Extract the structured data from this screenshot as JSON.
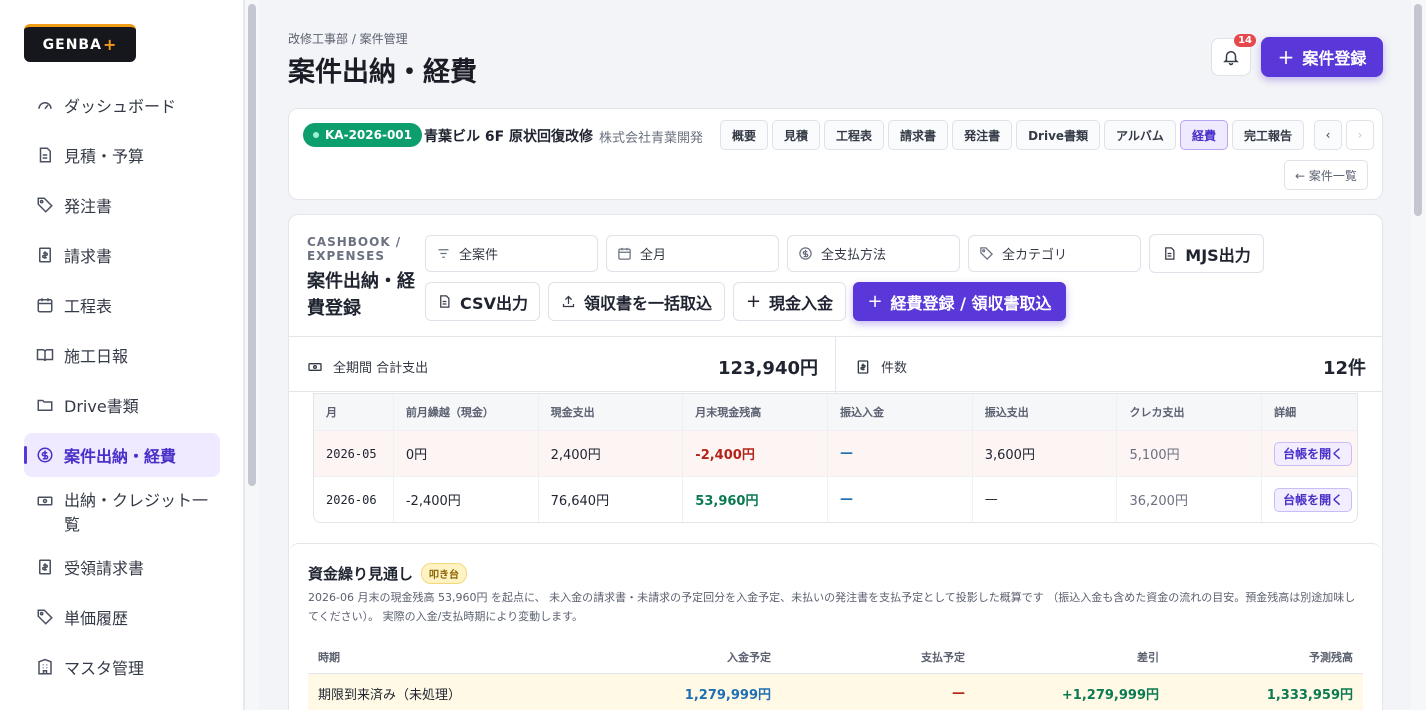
{
  "app": {
    "logo_text": "GENBA",
    "logo_plus": "+"
  },
  "sidebar": {
    "items": [
      {
        "label": "ダッシュボード",
        "icon": "gauge-icon"
      },
      {
        "label": "見積・予算",
        "icon": "document-icon"
      },
      {
        "label": "発注書",
        "icon": "tag-icon"
      },
      {
        "label": "請求書",
        "icon": "invoice-icon"
      },
      {
        "label": "工程表",
        "icon": "calendar-icon"
      },
      {
        "label": "施工日報",
        "icon": "book-icon"
      },
      {
        "label": "Drive書類",
        "icon": "folder-icon"
      },
      {
        "label": "案件出納・経費",
        "icon": "dollar-circle-icon",
        "active": true
      },
      {
        "label": "出納・クレジット一覧",
        "icon": "cash-icon"
      },
      {
        "label": "受領請求書",
        "icon": "invoice-icon"
      },
      {
        "label": "単価履歴",
        "icon": "tag-icon"
      },
      {
        "label": "マスタ管理",
        "icon": "building-icon"
      }
    ]
  },
  "header": {
    "breadcrumb": "改修工事部 / 案件管理",
    "title": "案件出納・経費",
    "notification_count": "14",
    "new_project_label": "案件登録"
  },
  "project": {
    "code": "KA-2026-001",
    "name": "青葉ビル 6F 原状回復改修",
    "client": "株式会社青葉開発",
    "tabs": [
      "概要",
      "見積",
      "工程表",
      "請求書",
      "発注書",
      "Drive書類",
      "アルバム",
      "経費",
      "完工報告"
    ],
    "active_tab": "経費",
    "back_label": "← 案件一覧",
    "prev_arrow": "‹",
    "next_arrow": "›"
  },
  "cashbook": {
    "subtitle": "CASHBOOK / EXPENSES",
    "title": "案件出納・経費登録",
    "filters": {
      "project": "全案件",
      "month": "全月",
      "payment_method": "全支払方法",
      "category": "全カテゴリ"
    },
    "buttons": {
      "mjs": "MJS出力",
      "csv": "CSV出力",
      "bulk_receipt": "領収書を一括取込",
      "cash_in": "現金入金",
      "register": "経費登録 / 領収書取込"
    },
    "stats": {
      "total_label": "全期間 合計支出",
      "total_value": "123,940円",
      "count_label": "件数",
      "count_value": "12件"
    },
    "monthly_table": {
      "headers": [
        "月",
        "前月繰越（現金）",
        "現金支出",
        "月末現金残高",
        "振込入金",
        "振込支出",
        "クレカ支出",
        "詳細"
      ],
      "rows": [
        {
          "month": "2026-05",
          "carry": "0円",
          "cash_out": "2,400円",
          "balance": "-2,400円",
          "transfer_in": "—",
          "transfer_out": "3,600円",
          "card": "5,100円",
          "action": "台帳を開く"
        },
        {
          "month": "2026-06",
          "carry": "-2,400円",
          "cash_out": "76,640円",
          "balance": "53,960円",
          "transfer_in": "—",
          "transfer_out": "—",
          "card": "36,200円",
          "action": "台帳を開く"
        }
      ]
    }
  },
  "forecast": {
    "title": "資金繰り見通し",
    "badge": "叩き台",
    "description": "2026-06 月末の現金残高 53,960円 を起点に、 未入金の請求書・未請求の予定回分を入金予定、未払いの発注書を支払予定として投影した概算です （振込入金も含めた資金の流れの目安。預金残高は別途加味してください）。 実際の入金/支払時期により変動します。",
    "headers": [
      "時期",
      "入金予定",
      "支払予定",
      "差引",
      "予測残高"
    ],
    "rows": [
      {
        "period": "期限到来済み（未処理）",
        "income": "1,279,999円",
        "payment": "—",
        "diff": "+1,279,999円",
        "balance": "1,333,959円"
      }
    ]
  },
  "colors": {
    "accent": "#5a37d8",
    "success": "#0d9e6e",
    "danger": "#b42318"
  }
}
